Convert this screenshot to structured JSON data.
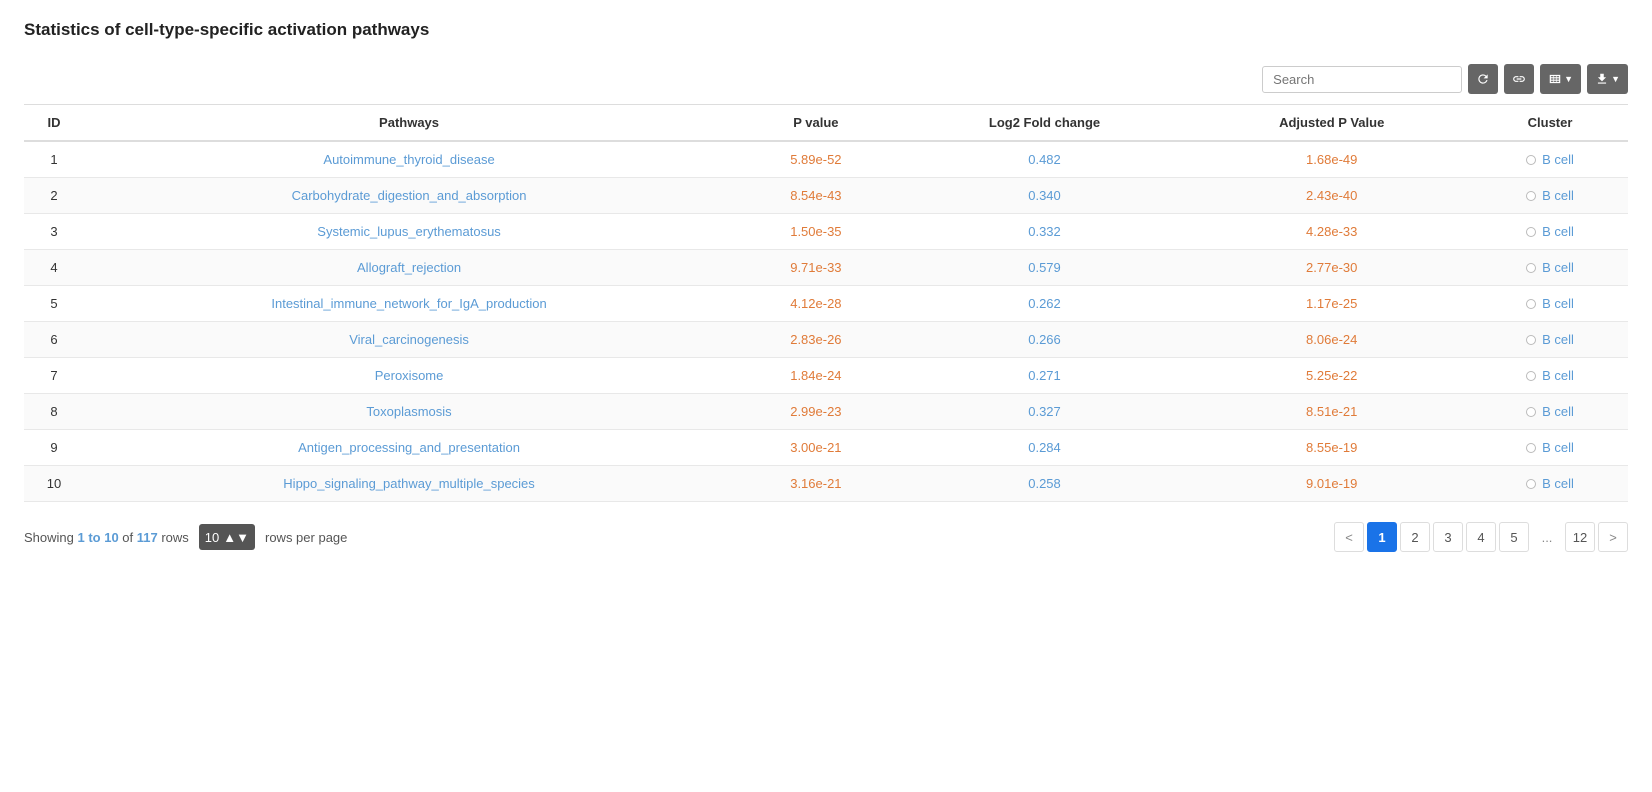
{
  "page": {
    "title": "Statistics of cell-type-specific activation pathways"
  },
  "toolbar": {
    "search_placeholder": "Search",
    "refresh_label": "Refresh",
    "link_label": "Link",
    "columns_label": "Columns",
    "download_label": "Download"
  },
  "table": {
    "columns": [
      "ID",
      "Pathways",
      "P value",
      "Log2 Fold change",
      "Adjusted P Value",
      "Cluster"
    ],
    "rows": [
      {
        "id": 1,
        "pathway": "Autoimmune_thyroid_disease",
        "pvalue": "5.89e-52",
        "log2fc": "0.482",
        "adj_pvalue": "1.68e-49",
        "cluster": "B cell"
      },
      {
        "id": 2,
        "pathway": "Carbohydrate_digestion_and_absorption",
        "pvalue": "8.54e-43",
        "log2fc": "0.340",
        "adj_pvalue": "2.43e-40",
        "cluster": "B cell"
      },
      {
        "id": 3,
        "pathway": "Systemic_lupus_erythematosus",
        "pvalue": "1.50e-35",
        "log2fc": "0.332",
        "adj_pvalue": "4.28e-33",
        "cluster": "B cell"
      },
      {
        "id": 4,
        "pathway": "Allograft_rejection",
        "pvalue": "9.71e-33",
        "log2fc": "0.579",
        "adj_pvalue": "2.77e-30",
        "cluster": "B cell"
      },
      {
        "id": 5,
        "pathway": "Intestinal_immune_network_for_IgA_production",
        "pvalue": "4.12e-28",
        "log2fc": "0.262",
        "adj_pvalue": "1.17e-25",
        "cluster": "B cell"
      },
      {
        "id": 6,
        "pathway": "Viral_carcinogenesis",
        "pvalue": "2.83e-26",
        "log2fc": "0.266",
        "adj_pvalue": "8.06e-24",
        "cluster": "B cell"
      },
      {
        "id": 7,
        "pathway": "Peroxisome",
        "pvalue": "1.84e-24",
        "log2fc": "0.271",
        "adj_pvalue": "5.25e-22",
        "cluster": "B cell"
      },
      {
        "id": 8,
        "pathway": "Toxoplasmosis",
        "pvalue": "2.99e-23",
        "log2fc": "0.327",
        "adj_pvalue": "8.51e-21",
        "cluster": "B cell"
      },
      {
        "id": 9,
        "pathway": "Antigen_processing_and_presentation",
        "pvalue": "3.00e-21",
        "log2fc": "0.284",
        "adj_pvalue": "8.55e-19",
        "cluster": "B cell"
      },
      {
        "id": 10,
        "pathway": "Hippo_signaling_pathway_multiple_species",
        "pvalue": "3.16e-21",
        "log2fc": "0.258",
        "adj_pvalue": "9.01e-19",
        "cluster": "B cell"
      }
    ]
  },
  "footer": {
    "showing_prefix": "Showing",
    "showing_range": "1 to 10",
    "showing_of": "of",
    "showing_total": "117",
    "showing_suffix": "rows",
    "rows_per_page_value": "10",
    "rows_per_page_label": "rows per page"
  },
  "pagination": {
    "prev_label": "<",
    "next_label": ">",
    "pages": [
      "1",
      "2",
      "3",
      "4",
      "5",
      "...",
      "12"
    ],
    "active_page": "1"
  }
}
